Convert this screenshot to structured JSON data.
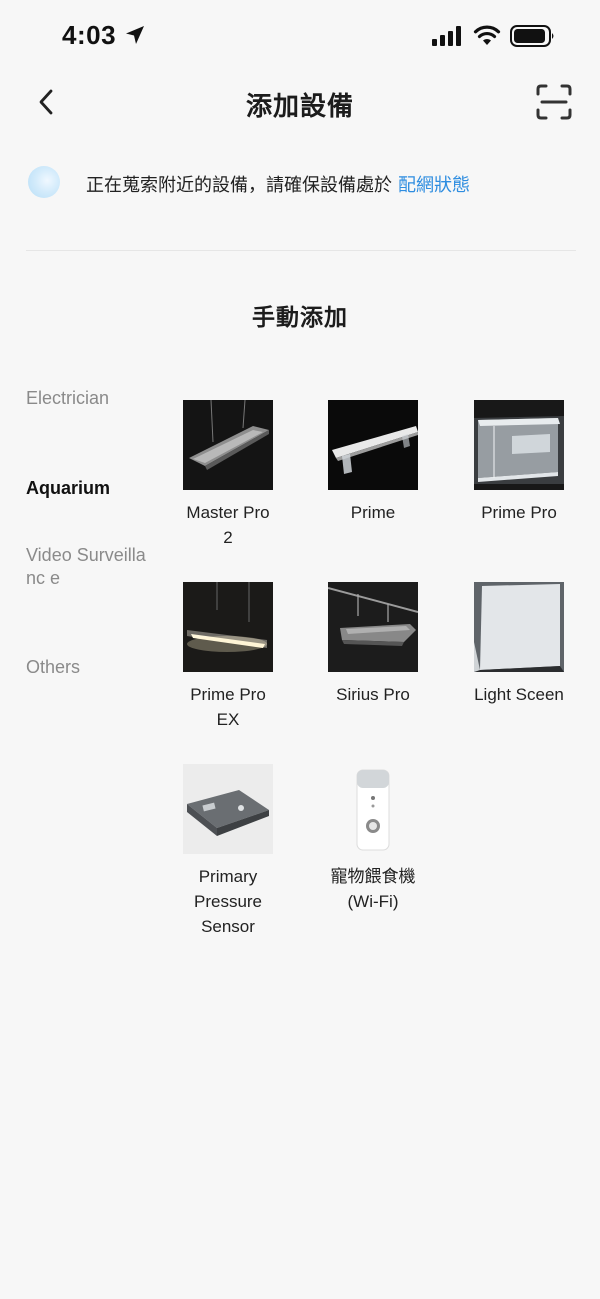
{
  "status_bar": {
    "time": "4:03",
    "icons": [
      "location-arrow-icon",
      "cellular-signal-icon",
      "wifi-icon",
      "battery-icon"
    ]
  },
  "nav": {
    "title": "添加設備",
    "back_icon": "chevron-left-icon",
    "scan_icon": "scan-frame-icon"
  },
  "scanning": {
    "text": "正在蒐索附近的設備，請確保設備處於",
    "link": "配網狀態",
    "link_color": "#2e8de0"
  },
  "manual": {
    "title": "手動添加"
  },
  "categories": [
    {
      "label": "Electrician",
      "active": false
    },
    {
      "label": "Aquarium",
      "active": true
    },
    {
      "label": "Video Surveillanc e",
      "active": false
    },
    {
      "label": "Others",
      "active": false
    }
  ],
  "devices": [
    {
      "lines": [
        "Master Pro",
        "2"
      ],
      "image": "pendant-aquarium-light"
    },
    {
      "lines": [
        "Prime"
      ],
      "image": "bar-aquarium-light"
    },
    {
      "lines": [
        "Prime Pro"
      ],
      "image": "clear-acrylic-light"
    },
    {
      "lines": [
        "Prime Pro",
        "EX"
      ],
      "image": "glowing-bar-light"
    },
    {
      "lines": [
        "Sirius Pro"
      ],
      "image": "hanging-fixture-light"
    },
    {
      "lines": [
        "Light Sceen"
      ],
      "image": "light-panel"
    },
    {
      "lines": [
        "Primary",
        "Pressure",
        "Sensor"
      ],
      "image": "pressure-sensor-module"
    },
    {
      "lines": [
        "寵物餵食機",
        "(Wi-Fi)"
      ],
      "image": "pet-feeder"
    }
  ]
}
